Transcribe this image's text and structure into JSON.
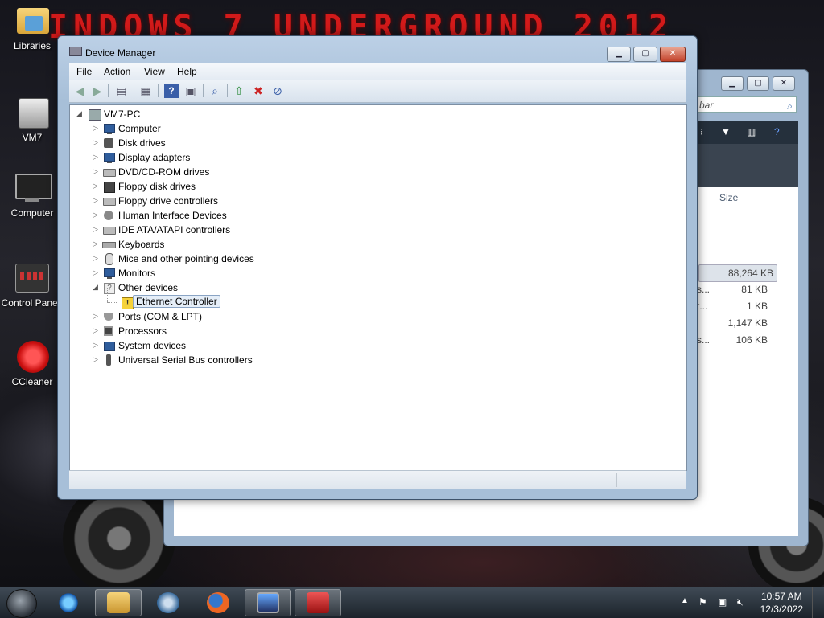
{
  "desktop": {
    "banner": "INDOWS 7 UNDERGROUND 2012",
    "icons": [
      {
        "label": "Libraries",
        "icon": "libraries-folder-icon"
      },
      {
        "label": "VM7",
        "icon": "user-folder-icon"
      },
      {
        "label": "Computer",
        "icon": "computer-icon"
      },
      {
        "label": "Control Panel",
        "icon": "control-panel-icon"
      },
      {
        "label": "CCleaner",
        "icon": "ccleaner-icon"
      }
    ]
  },
  "background_window": {
    "search_text": "bar",
    "column_size": "Size",
    "rows": [
      {
        "text": "",
        "size": "88,264 KB"
      },
      {
        "text": "s...",
        "size": "81 KB"
      },
      {
        "text": "t...",
        "size": "1 KB"
      },
      {
        "text": "",
        "size": "1,147 KB"
      },
      {
        "text": "s...",
        "size": "106 KB"
      }
    ]
  },
  "device_manager": {
    "title": "Device Manager",
    "menu": [
      "File",
      "Action",
      "View",
      "Help"
    ],
    "toolbar_icons": [
      "back-arrow-icon",
      "forward-arrow-icon",
      "show-hide-console-tree-icon",
      "properties-icon",
      "help-icon",
      "show-hide-action-pane-icon",
      "scan-hardware-icon",
      "update-driver-icon",
      "uninstall-icon",
      "disable-device-icon"
    ],
    "tree": {
      "root": "VM7-PC",
      "items": [
        {
          "label": "Computer",
          "icon": "ic-monitor",
          "expanded": false
        },
        {
          "label": "Disk drives",
          "icon": "ic-disk",
          "expanded": false
        },
        {
          "label": "Display adapters",
          "icon": "ic-monitor",
          "expanded": false
        },
        {
          "label": "DVD/CD-ROM drives",
          "icon": "ic-drive",
          "expanded": false
        },
        {
          "label": "Floppy disk drives",
          "icon": "ic-floppy",
          "expanded": false
        },
        {
          "label": "Floppy drive controllers",
          "icon": "ic-drive",
          "expanded": false
        },
        {
          "label": "Human Interface Devices",
          "icon": "ic-hid",
          "expanded": false
        },
        {
          "label": "IDE ATA/ATAPI controllers",
          "icon": "ic-drive",
          "expanded": false
        },
        {
          "label": "Keyboards",
          "icon": "ic-keyboard",
          "expanded": false
        },
        {
          "label": "Mice and other pointing devices",
          "icon": "ic-mouse",
          "expanded": false
        },
        {
          "label": "Monitors",
          "icon": "ic-monitor",
          "expanded": false
        },
        {
          "label": "Other devices",
          "icon": "ic-other",
          "expanded": true
        },
        {
          "label": "Ethernet Controller",
          "icon": "ic-warn",
          "child": true,
          "selected": true
        },
        {
          "label": "Ports (COM & LPT)",
          "icon": "ic-port",
          "expanded": false
        },
        {
          "label": "Processors",
          "icon": "ic-cpu",
          "expanded": false
        },
        {
          "label": "System devices",
          "icon": "ic-system",
          "expanded": false
        },
        {
          "label": "Universal Serial Bus controllers",
          "icon": "ic-usb",
          "expanded": false
        }
      ]
    }
  },
  "taskbar": {
    "time": "10:57 AM",
    "date": "12/3/2022",
    "items": [
      "internet-explorer-icon",
      "windows-explorer-icon",
      "windows-media-player-icon",
      "firefox-icon",
      "remote-desktop-icon",
      "toolbox-icon"
    ]
  },
  "colors": {
    "accent": "#d21a1a",
    "window_frame": "#a7bfd8",
    "taskbar": "#1c232b"
  }
}
